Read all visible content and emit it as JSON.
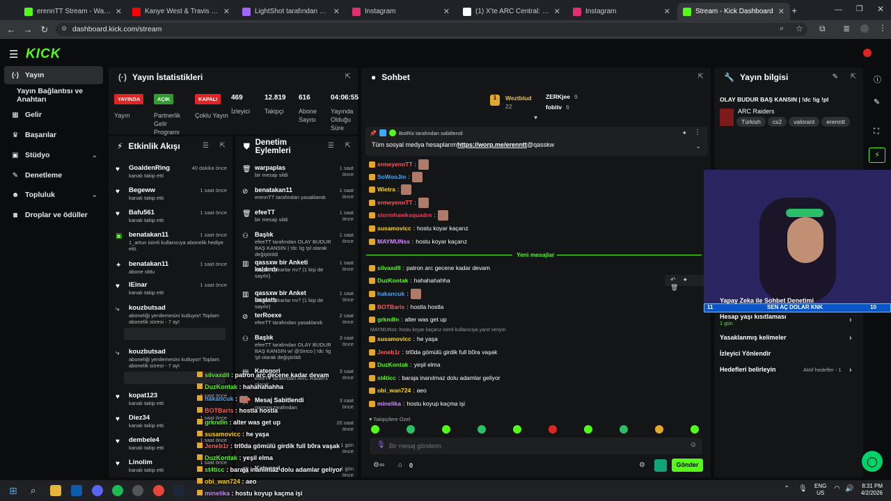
{
  "browser": {
    "tabs": [
      {
        "title": "erennTT Stream - Watch Live o",
        "color": "#53fc18"
      },
      {
        "title": "Kanye West & Travis Scott Mak",
        "color": "#ff0000"
      },
      {
        "title": "LightShot tarafından Ekran Gör",
        "color": "#a066ff"
      },
      {
        "title": "Instagram",
        "color": "#e1306c"
      },
      {
        "title": "(1) X'te ARC Central: \"RAT raid",
        "color": "#ffffff"
      },
      {
        "title": "Instagram",
        "color": "#e1306c"
      },
      {
        "title": "Stream - Kick Dashboard",
        "color": "#53fc18"
      }
    ],
    "url": "dashboard.kick.com/stream"
  },
  "logo": "KICK",
  "sidebar": {
    "items": [
      {
        "label": "Yayın",
        "icon": "broadcast-icon"
      },
      {
        "label": "Yayın Bağlantısı ve Anahtarı",
        "icon": ""
      },
      {
        "label": "Gelir",
        "icon": "revenue-icon"
      },
      {
        "label": "Başarılar",
        "icon": "trophy-icon"
      },
      {
        "label": "Stüdyo",
        "icon": "studio-icon"
      },
      {
        "label": "Denetleme",
        "icon": "hammer-icon"
      },
      {
        "label": "Topluluk",
        "icon": "community-icon"
      },
      {
        "label": "Droplar ve ödüller",
        "icon": "gift-icon"
      }
    ]
  },
  "stats": {
    "title": "Yayın İstatistikleri",
    "items": [
      {
        "badge": "YAYINDA",
        "badge_color": "#e02424",
        "label": "Yayın"
      },
      {
        "badge": "AÇIK",
        "badge_color": "#2e9d2e",
        "label": "Partnerlik Gelir Programı"
      },
      {
        "badge": "KAPALI",
        "badge_color": "#e02424",
        "label": "Çoklu Yayın"
      },
      {
        "value": "469",
        "label": "İzleyici"
      },
      {
        "value": "12.819",
        "label": "Takipçi"
      },
      {
        "value": "616",
        "label": "Abone Sayısı"
      },
      {
        "value": "04:06:55",
        "label": "Yayında Olduğu Süre"
      }
    ]
  },
  "activity": {
    "title": "Etkinlik Akışı",
    "items": [
      {
        "name": "GoaldenRing",
        "sub": "kanalı takip etti",
        "time": "40 dakika önce",
        "icon": "heart-icon"
      },
      {
        "name": "Begeww",
        "sub": "kanalı takip etti",
        "time": "1 saat önce",
        "icon": "heart-icon"
      },
      {
        "name": "Bafu561",
        "sub": "kanalı takip etti",
        "time": "1 saat önce",
        "icon": "heart-icon"
      },
      {
        "name": "benatakan11",
        "sub": "1_artun isimli kullanıcıya abonelik hediye etti.",
        "time": "1 saat önce",
        "icon": "gift-icon"
      },
      {
        "name": "benatakan11",
        "sub": "abone oldu",
        "time": "1 saat önce",
        "icon": "star-icon"
      },
      {
        "name": "IEinar",
        "sub": "kanalı takip etti",
        "time": "1 saat önce",
        "icon": "heart-icon"
      },
      {
        "name": "kouzbutsad",
        "sub": "aboneliği yenilemesini kutluyor! Toplam abonelik süresi - 7 ay!",
        "time": "",
        "icon": "renew-icon"
      },
      {
        "name": "kouzbutsad",
        "sub": "aboneliği yenilemesini kutluyor! Toplam abonelik süresi - 7 ay!",
        "time": "",
        "icon": "renew-icon"
      },
      {
        "name": "kopat123",
        "sub": "kanalı takip etti",
        "time": "1 saat önce",
        "icon": "heart-icon"
      },
      {
        "name": "Diez34",
        "sub": "kanalı takip etti",
        "time": "1 saat önce",
        "icon": "heart-icon"
      },
      {
        "name": "dembele4",
        "sub": "kanalı takip etti",
        "time": "1 saat önce",
        "icon": "heart-icon"
      },
      {
        "name": "Linolim",
        "sub": "kanalı takip etti",
        "time": "1 saat önce",
        "icon": "heart-icon"
      }
    ]
  },
  "moderation": {
    "title": "Denetim Eylemleri",
    "items": [
      {
        "name": "warpaplas",
        "sub": "bir mesajı sildi",
        "time": "1 saat önce",
        "icon": "trash-icon"
      },
      {
        "name": "benatakan11",
        "sub": "erennTT tarafından yasaklandı",
        "time": "1 saat önce",
        "icon": "ban-icon"
      },
      {
        "name": "efeeTT",
        "sub": "bir mesajı sildi",
        "time": "1 saat önce",
        "icon": "trash-icon"
      },
      {
        "name": "Başlık",
        "sub": "efeeTT tarafından OLAY BUDUR BAŞ KANSIN | !dc !ig !pl olarak değiştirildi",
        "time": "1 saat önce",
        "icon": "title-icon"
      },
      {
        "name": "qassxw bir Anketi kaldırdı",
        "sub": "Mapten çıkarlar mı? (1 kişi de sayılır)",
        "time": "1 saat önce",
        "icon": "poll-icon"
      },
      {
        "name": "qassxw bir Anket başlattı",
        "sub": "Mapten çıkarlar mı? (1 kişi de sayılır)",
        "time": "1 saat önce",
        "icon": "poll-icon"
      },
      {
        "name": "terRoexe",
        "sub": "efeeTT tarafından yasaklandı",
        "time": "2 saat önce",
        "icon": "ban-icon"
      },
      {
        "name": "Başlık",
        "sub": "efeeTT tarafından OLAY BUDUR BAŞ KANSIN w/ @Sinco | !dc !ig !pl olarak değiştirildi",
        "time": "3 saat önce",
        "icon": "title-icon"
      },
      {
        "name": "Kategori",
        "sub": "efeeTT tarafından ARC Raiders olarak",
        "time": "3 saat önce",
        "icon": "category-icon"
      },
      {
        "name": "Mesaj Sabitlendi",
        "sub": "qassxw tarafından",
        "time": "3 saat önce",
        "icon": "pin-icon"
      },
      {
        "name": "",
        "sub": "",
        "time": "20 saat önce",
        "icon": ""
      },
      {
        "name": "",
        "sub": "",
        "time": "1 gün önce",
        "icon": ""
      },
      {
        "name": "Kategori",
        "sub": "",
        "time": "1 gün önce",
        "icon": "category-icon"
      }
    ]
  },
  "chat": {
    "title": "Sohbet",
    "top": [
      {
        "name": "Weztblud",
        "count": "22",
        "rank": "1"
      },
      {
        "name": "ZERKjee",
        "count": "9"
      },
      {
        "name": "fobitv",
        "count": "6"
      }
    ],
    "pinned": {
      "by": "BotRix tarafından sabitlendi",
      "text": "Tüm sosyal medya hesaplarım:",
      "link": "https://worp.me/erenntt",
      "after": "@qasskw"
    },
    "messages": [
      {
        "user": "ermeyennTT",
        "color": "#ff5a5a",
        "text": "",
        "emote": true
      },
      {
        "user": "SoWooJin",
        "color": "#3fa9ff",
        "text": "",
        "emote": true
      },
      {
        "user": "Wietra",
        "color": "#ffd700",
        "text": "",
        "emote": true
      },
      {
        "user": "ermeyennTT",
        "color": "#ff5a5a",
        "text": "",
        "emote": true
      },
      {
        "user": "stormhawksquadrn",
        "color": "#ff3355",
        "text": "",
        "emote": true
      },
      {
        "user": "susamovicc",
        "color": "#ffd700",
        "text": "hostu koyar kaçarız",
        "emote": false
      },
      {
        "user": "MAYMUNss",
        "color": "#d28cff",
        "text": "hostu koyar kaçarız",
        "emote": false
      }
    ],
    "new_label": "Yeni mesajlar",
    "new_messages": [
      {
        "user": "silvaxdll",
        "color": "#53fc18",
        "text": "patron arc gecene kadar devam",
        "emote": false
      },
      {
        "user": "DuzKontak",
        "color": "#53fc18",
        "text": "hahahahahha",
        "emote": false
      },
      {
        "user": "hakancuk",
        "color": "#3fa9ff",
        "text": "",
        "emote": true
      },
      {
        "user": "BOTBaris",
        "color": "#ff5a5a",
        "text": "hostla hostla",
        "emote": false
      },
      {
        "user": "grkndln",
        "color": "#53fc18",
        "text": "alter was get up",
        "emote": false
      },
      {
        "user": "susamovicc",
        "color": "#ffd700",
        "text": "he yaşa",
        "emote": false,
        "reply": "MAYMUNss: hostu koyar kaçarız isimli kullanıcıya yanıt veriyor"
      },
      {
        "user": "Jeneb1r",
        "color": "#ff5a5a",
        "text": "trl0da gömülü girdik full b0ra vaşak",
        "emote": false
      },
      {
        "user": "DuzKontak",
        "color": "#53fc18",
        "text": "yeşil elma",
        "emote": false
      },
      {
        "user": "st4ticc",
        "color": "#53fc18",
        "text": "baraja inanılmaz dolu adamlar geliyor",
        "emote": false
      },
      {
        "user": "obi_wan724",
        "color": "#ffd700",
        "text": "aeo",
        "emote": false
      },
      {
        "user": "minelika",
        "color": "#d28cff",
        "text": "hostu koyup kaçma işi",
        "emote": false
      }
    ],
    "followers_only": "Takipçilere Özel",
    "input_placeholder": "Bir mesaj gönderin",
    "points": "0",
    "send": "Gönder"
  },
  "overlay": [
    {
      "user": "silvaxdll",
      "color": "#53fc18",
      "text": "patron arc gecene kadar devam"
    },
    {
      "user": "DuzKontak",
      "color": "#53fc18",
      "text": "hahahahahha"
    },
    {
      "user": "hakancuk",
      "color": "#3fa9ff",
      "text": ""
    },
    {
      "user": "BOTBaris",
      "color": "#ff5a5a",
      "text": "hostla hostla"
    },
    {
      "user": "grkndln",
      "color": "#53fc18",
      "text": "alter was get up"
    },
    {
      "user": "susamovicc",
      "color": "#ffd700",
      "text": "he yaşa"
    },
    {
      "user": "Jeneb1r",
      "color": "#ff5a5a",
      "text": "trl0da gömülü girdik full b0ra vaşak"
    },
    {
      "user": "DuzKontak",
      "color": "#53fc18",
      "text": "yeşil elma"
    },
    {
      "user": "st4ticc",
      "color": "#53fc18",
      "text": "baraja inanılmaz dolu adamlar geliyor"
    },
    {
      "user": "obi_wan724",
      "color": "#ffd700",
      "text": "aeo"
    },
    {
      "user": "minelika",
      "color": "#d28cff",
      "text": "hostu koyup kaçma işi"
    }
  ],
  "info": {
    "title": "Yayın bilgisi",
    "stream_title": "OLAY BUDUR BAŞ KANSIN | !dc !ig !pl",
    "category": "ARC Raiders",
    "tags": [
      "Türkish",
      "cs2",
      "valorant",
      "erenntt"
    ],
    "items": [
      {
        "label": "Yapay Zeka ile Sohbet Denetimi",
        "sub": ""
      },
      {
        "label": "Hesap yaşı kısıtlaması",
        "sub": "1 gün"
      },
      {
        "label": "Yasaklanmış kelimeler",
        "sub": ""
      },
      {
        "label": "İzleyici Yönlendir",
        "sub": ""
      },
      {
        "label": "Hedefleri belirleyin",
        "sub": "Aktif hedefler - 1"
      }
    ]
  },
  "goal_bar": {
    "left": "11",
    "label": "SEN AÇ DOLAR KNK",
    "right": "10",
    "progress": 0.0
  },
  "taskbar": {
    "lang1": "ENG",
    "lang2": "US",
    "time": "8:31 PM",
    "date": "4/2/2026"
  }
}
